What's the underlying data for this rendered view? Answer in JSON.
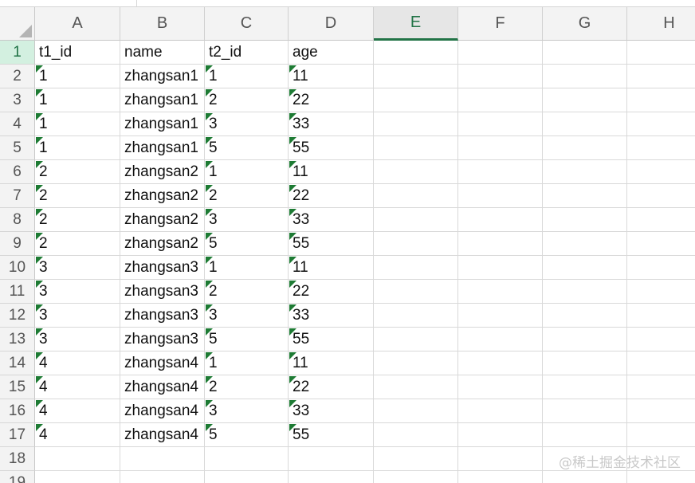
{
  "columns": [
    "A",
    "B",
    "C",
    "D",
    "E",
    "F",
    "G",
    "H"
  ],
  "selected_column": "E",
  "row_numbers": [
    "1",
    "2",
    "3",
    "4",
    "5",
    "6",
    "7",
    "8",
    "9",
    "10",
    "11",
    "12",
    "13",
    "14",
    "15",
    "16",
    "17",
    "18",
    "19"
  ],
  "selected_row": "1",
  "rows": [
    [
      "t1_id",
      "name",
      "t2_id",
      "age"
    ],
    [
      "1",
      "zhangsan1",
      "1",
      "11"
    ],
    [
      "1",
      "zhangsan1",
      "2",
      "22"
    ],
    [
      "1",
      "zhangsan1",
      "3",
      "33"
    ],
    [
      "1",
      "zhangsan1",
      "5",
      "55"
    ],
    [
      "2",
      "zhangsan2",
      "1",
      "11"
    ],
    [
      "2",
      "zhangsan2",
      "2",
      "22"
    ],
    [
      "2",
      "zhangsan2",
      "3",
      "33"
    ],
    [
      "2",
      "zhangsan2",
      "5",
      "55"
    ],
    [
      "3",
      "zhangsan3",
      "1",
      "11"
    ],
    [
      "3",
      "zhangsan3",
      "2",
      "22"
    ],
    [
      "3",
      "zhangsan3",
      "3",
      "33"
    ],
    [
      "3",
      "zhangsan3",
      "5",
      "55"
    ],
    [
      "4",
      "zhangsan4",
      "1",
      "11"
    ],
    [
      "4",
      "zhangsan4",
      "2",
      "22"
    ],
    [
      "4",
      "zhangsan4",
      "3",
      "33"
    ],
    [
      "4",
      "zhangsan4",
      "5",
      "55"
    ],
    [
      "",
      "",
      "",
      ""
    ],
    [
      "",
      "",
      "",
      ""
    ]
  ],
  "number_stored_as_text_columns": [
    "A",
    "C",
    "D"
  ],
  "colors": {
    "accent": "#217346",
    "warning_triangle": "#1e7b34",
    "header_bg": "#f3f3f3"
  },
  "watermark": "@稀土掘金技术社区"
}
